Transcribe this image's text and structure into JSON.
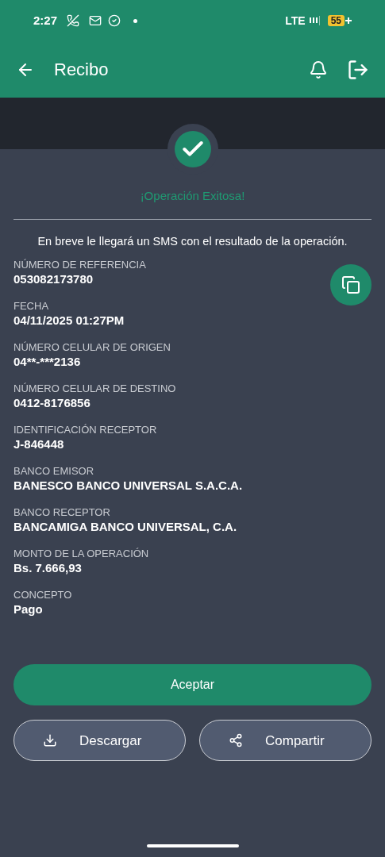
{
  "status_bar": {
    "time": "2:27",
    "network": "LTE",
    "battery": "55"
  },
  "app_bar": {
    "title": "Recibo"
  },
  "result": {
    "title": "¡Operación Exitosa!",
    "message": "En breve le llegará un SMS con el resultado de la operación."
  },
  "fields": [
    {
      "label": "NÚMERO DE REFERENCIA",
      "value": "053082173780"
    },
    {
      "label": "FECHA",
      "value": "04/11/2025 01:27PM"
    },
    {
      "label": "NÚMERO CELULAR DE ORIGEN",
      "value": "04**-***2136"
    },
    {
      "label": "NÚMERO CELULAR DE DESTINO",
      "value": "0412-8176856"
    },
    {
      "label": "IDENTIFICACIÓN RECEPTOR",
      "value": "J-846448"
    },
    {
      "label": "BANCO EMISOR",
      "value": "BANESCO BANCO UNIVERSAL S.A.C.A."
    },
    {
      "label": "BANCO RECEPTOR",
      "value": "BANCAMIGA BANCO UNIVERSAL, C.A."
    },
    {
      "label": "MONTO DE LA OPERACIÓN",
      "value": "Bs. 7.666,93"
    },
    {
      "label": "CONCEPTO",
      "value": "Pago"
    }
  ],
  "buttons": {
    "primary": "Aceptar",
    "secondary": [
      {
        "kind": "download",
        "label": "Descargar"
      },
      {
        "kind": "share",
        "label": "Compartir"
      }
    ]
  }
}
